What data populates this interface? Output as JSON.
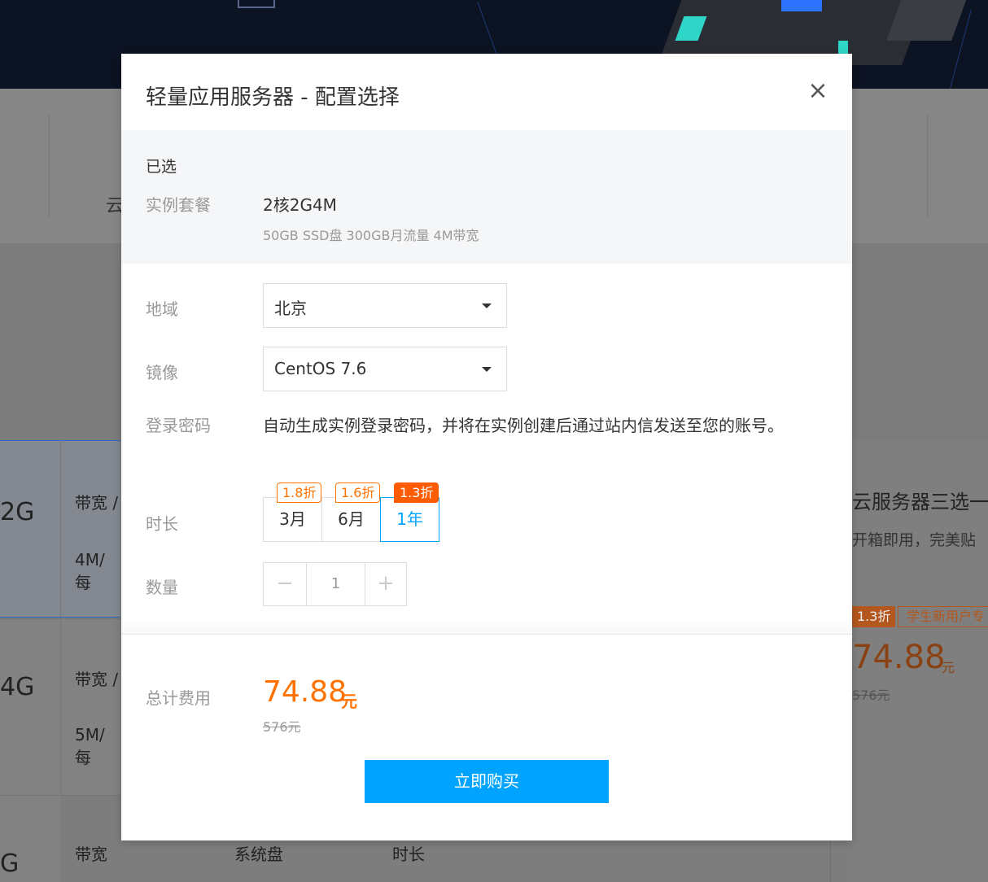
{
  "background": {
    "strip_text": "云",
    "rows": [
      {
        "size": "2G",
        "label": "带宽 /",
        "value": "4M/每"
      },
      {
        "size": "4G",
        "label": "带宽 /",
        "value": "5M/每"
      },
      {
        "size": "G"
      }
    ],
    "bottom_columns": [
      "带宽",
      "系统盘",
      "时长"
    ],
    "right_card": {
      "title": "云服务器三选一",
      "desc": "开箱即用，完美贴",
      "discount": "1.3折",
      "tag": "学生新用户专",
      "price": "74.88",
      "unit": "元",
      "original": "576元"
    }
  },
  "modal": {
    "title": "轻量应用服务器 - 配置选择",
    "close_symbol": "×",
    "selected": {
      "heading": "已选",
      "package_label": "实例套餐",
      "package_value": "2核2G4M",
      "package_detail": "50GB SSD盘 300GB月流量 4M带宽"
    },
    "region": {
      "label": "地域",
      "value": "北京"
    },
    "image": {
      "label": "镜像",
      "value": "CentOS 7.6"
    },
    "password": {
      "label": "登录密码",
      "text": "自动生成实例登录密码，并将在实例创建后通过站内信发送至您的账号。"
    },
    "duration": {
      "label": "时长",
      "options": [
        {
          "label": "3月",
          "discount": "1.8折",
          "selected": false
        },
        {
          "label": "6月",
          "discount": "1.6折",
          "selected": false
        },
        {
          "label": "1年",
          "discount": "1.3折",
          "selected": true
        }
      ]
    },
    "quantity": {
      "label": "数量",
      "minus": "−",
      "value": "1",
      "plus": "+"
    },
    "total": {
      "label": "总计费用",
      "price": "74.88",
      "unit": "元",
      "original": "576元"
    },
    "buy_label": "立即购买"
  },
  "colors": {
    "accent": "#00a4ff",
    "price": "#ff7200",
    "discount_hot": "#ff5b00"
  }
}
